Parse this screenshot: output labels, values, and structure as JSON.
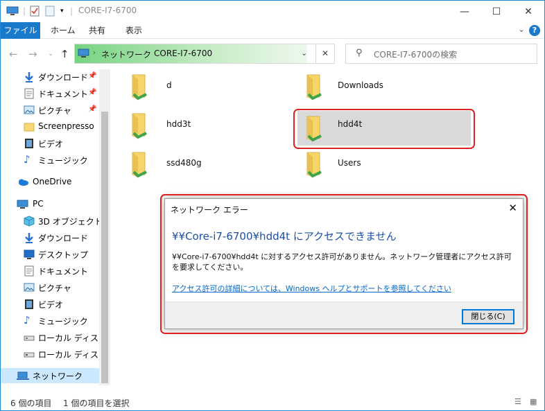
{
  "window": {
    "title": "CORE-I7-6700",
    "controls": [
      "minimize-icon",
      "maximize-icon",
      "close-icon"
    ]
  },
  "ribbon": {
    "tabs": [
      "ファイル",
      "ホーム",
      "共有",
      "表示"
    ],
    "help_label": "?"
  },
  "address": {
    "crumbs": [
      "ネットワーク",
      "CORE-I7-6700"
    ],
    "search_placeholder": "CORE-I7-6700の検索"
  },
  "sidebar": {
    "items": [
      {
        "label": "ダウンロード",
        "icon": "download-arrow-icon",
        "pinned": true
      },
      {
        "label": "ドキュメント",
        "icon": "document-icon",
        "pinned": true
      },
      {
        "label": "ピクチャ",
        "icon": "picture-icon",
        "pinned": true
      },
      {
        "label": "Screenpresso",
        "icon": "folder-icon",
        "pinned": false
      },
      {
        "label": "ビデオ",
        "icon": "video-icon",
        "pinned": false
      },
      {
        "label": "ミュージック",
        "icon": "music-note-icon",
        "pinned": false
      },
      {
        "label": "OneDrive",
        "icon": "cloud-icon",
        "pinned": false
      },
      {
        "label": "PC",
        "icon": "pc-icon",
        "pinned": false
      },
      {
        "label": "3D オブジェクト",
        "icon": "cube-icon",
        "pinned": false
      },
      {
        "label": "ダウンロード",
        "icon": "download-arrow-icon",
        "pinned": false
      },
      {
        "label": "デスクトップ",
        "icon": "desktop-icon",
        "pinned": false
      },
      {
        "label": "ドキュメント",
        "icon": "document-icon",
        "pinned": false
      },
      {
        "label": "ピクチャ",
        "icon": "picture-icon",
        "pinned": false
      },
      {
        "label": "ビデオ",
        "icon": "video-icon",
        "pinned": false
      },
      {
        "label": "ミュージック",
        "icon": "music-note-icon",
        "pinned": false
      },
      {
        "label": "ローカル ディスク (C",
        "icon": "drive-icon",
        "pinned": false
      },
      {
        "label": "ローカル ディスク (D",
        "icon": "drive-icon",
        "pinned": false
      },
      {
        "label": "ネットワーク",
        "icon": "network-icon",
        "pinned": false
      }
    ]
  },
  "folders": [
    {
      "label": "d"
    },
    {
      "label": "Downloads"
    },
    {
      "label": "hdd3t"
    },
    {
      "label": "hdd4t"
    },
    {
      "label": "ssd480g"
    },
    {
      "label": "Users"
    }
  ],
  "status": {
    "item_count": "6 個の項目",
    "selected": "1 個の項目を選択"
  },
  "dialog": {
    "title": "ネットワーク エラー",
    "heading": "¥¥Core-i7-6700¥hdd4t にアクセスできません",
    "message": "¥¥Core-i7-6700¥hdd4t に対するアクセス許可がありません。ネットワーク管理者にアクセス許可を要求してください。",
    "link": "アクセス許可の詳細については、Windows ヘルプとサポートを参照してください",
    "button": "閉じる(C)"
  },
  "colors": {
    "accent": "#1979ca",
    "highlight": "#e02020",
    "address_green": "#77d381",
    "link": "#0066cc"
  }
}
